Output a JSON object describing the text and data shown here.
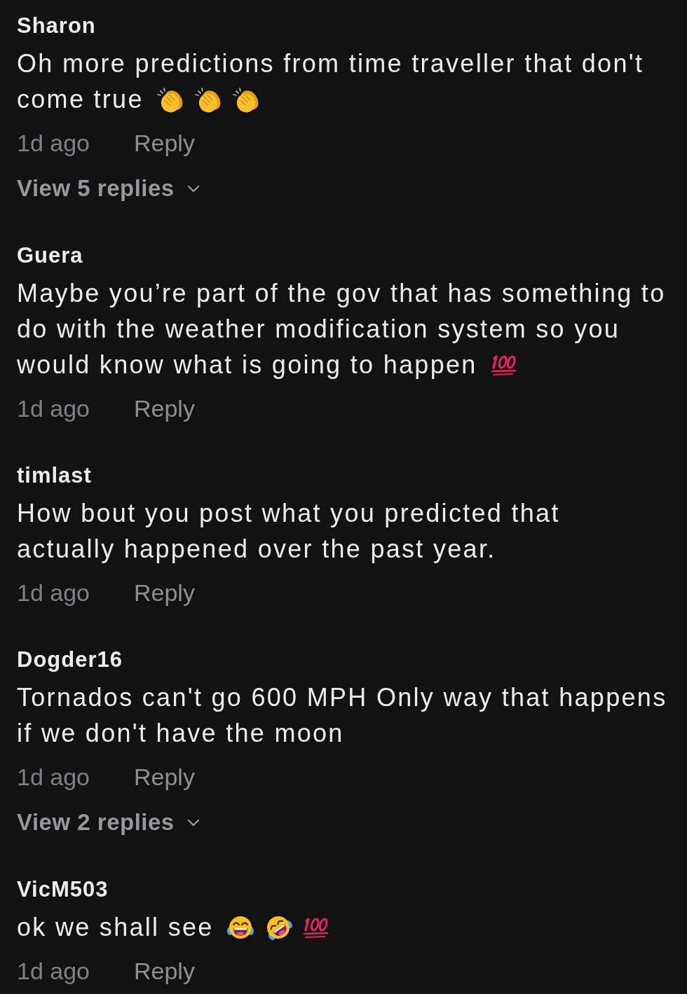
{
  "comments": [
    {
      "username": "Sharon",
      "lines": [
        "Oh more predictions from time traveller that don't",
        "come true"
      ],
      "emojis": [
        {
          "kind": "clap"
        },
        {
          "kind": "clap"
        },
        {
          "kind": "clap"
        }
      ],
      "time": "1d ago",
      "reply": "Reply",
      "view_replies": "View 5 replies"
    },
    {
      "username": "Guera",
      "lines": [
        "Maybe you’re part of the gov that has something to",
        "do with the weather modification system so you",
        "would know what is going to happen"
      ],
      "emojis": [
        {
          "kind": "hundred"
        }
      ],
      "time": "1d ago",
      "reply": "Reply"
    },
    {
      "username": "timlast",
      "lines": [
        "How bout you post what you predicted that",
        "actually happened over the past year."
      ],
      "time": "1d ago",
      "reply": "Reply"
    },
    {
      "username": "Dogder16",
      "lines": [
        "Tornados can't go 600 MPH Only way that happens",
        "if we don't have the moon"
      ],
      "time": "1d ago",
      "reply": "Reply",
      "view_replies": "View 2 replies"
    },
    {
      "username": "VicM503",
      "lines": [
        "ok we shall see"
      ],
      "emojis": [
        {
          "kind": "tears-of-joy"
        },
        {
          "kind": "rolling-laugh"
        },
        {
          "kind": "hundred"
        }
      ],
      "time": "1d ago",
      "reply": "Reply"
    }
  ]
}
